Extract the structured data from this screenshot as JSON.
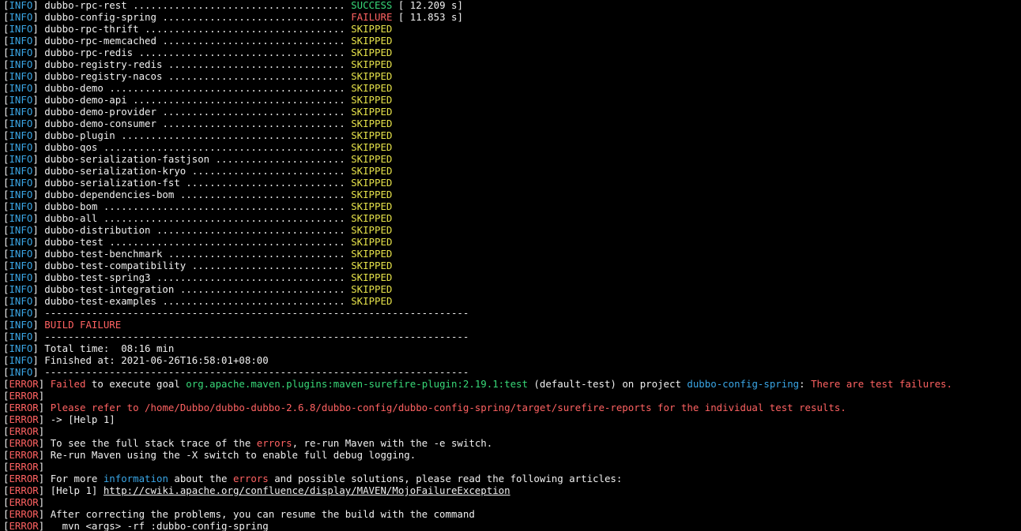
{
  "colors": {
    "background": "#000000",
    "text": "#f0f0f0",
    "info_level": "#3aa6e6",
    "error_level": "#ff6262",
    "success": "#38d878",
    "failure": "#ff6262",
    "skipped": "#e6e24a"
  },
  "modules": [
    {
      "name": "dubbo-rpc-rest",
      "dots": "....................................",
      "status": "SUCCESS",
      "time": " [ 12.209 s]"
    },
    {
      "name": "dubbo-config-spring",
      "dots": "...............................",
      "status": "FAILURE",
      "time": " [ 11.853 s]"
    },
    {
      "name": "dubbo-rpc-thrift",
      "dots": "..................................",
      "status": "SKIPPED",
      "time": ""
    },
    {
      "name": "dubbo-rpc-memcached",
      "dots": "...............................",
      "status": "SKIPPED",
      "time": ""
    },
    {
      "name": "dubbo-rpc-redis",
      "dots": "...................................",
      "status": "SKIPPED",
      "time": ""
    },
    {
      "name": "dubbo-registry-redis",
      "dots": "..............................",
      "status": "SKIPPED",
      "time": ""
    },
    {
      "name": "dubbo-registry-nacos",
      "dots": "..............................",
      "status": "SKIPPED",
      "time": ""
    },
    {
      "name": "dubbo-demo",
      "dots": "........................................",
      "status": "SKIPPED",
      "time": ""
    },
    {
      "name": "dubbo-demo-api",
      "dots": "....................................",
      "status": "SKIPPED",
      "time": ""
    },
    {
      "name": "dubbo-demo-provider",
      "dots": "...............................",
      "status": "SKIPPED",
      "time": ""
    },
    {
      "name": "dubbo-demo-consumer",
      "dots": "...............................",
      "status": "SKIPPED",
      "time": ""
    },
    {
      "name": "dubbo-plugin",
      "dots": "......................................",
      "status": "SKIPPED",
      "time": ""
    },
    {
      "name": "dubbo-qos",
      "dots": ".........................................",
      "status": "SKIPPED",
      "time": ""
    },
    {
      "name": "dubbo-serialization-fastjson",
      "dots": "......................",
      "status": "SKIPPED",
      "time": ""
    },
    {
      "name": "dubbo-serialization-kryo",
      "dots": "..........................",
      "status": "SKIPPED",
      "time": ""
    },
    {
      "name": "dubbo-serialization-fst",
      "dots": "...........................",
      "status": "SKIPPED",
      "time": ""
    },
    {
      "name": "dubbo-dependencies-bom",
      "dots": "............................",
      "status": "SKIPPED",
      "time": ""
    },
    {
      "name": "dubbo-bom",
      "dots": ".........................................",
      "status": "SKIPPED",
      "time": ""
    },
    {
      "name": "dubbo-all",
      "dots": ".........................................",
      "status": "SKIPPED",
      "time": ""
    },
    {
      "name": "dubbo-distribution",
      "dots": "................................",
      "status": "SKIPPED",
      "time": ""
    },
    {
      "name": "dubbo-test",
      "dots": "........................................",
      "status": "SKIPPED",
      "time": ""
    },
    {
      "name": "dubbo-test-benchmark",
      "dots": "..............................",
      "status": "SKIPPED",
      "time": ""
    },
    {
      "name": "dubbo-test-compatibility",
      "dots": "..........................",
      "status": "SKIPPED",
      "time": ""
    },
    {
      "name": "dubbo-test-spring3",
      "dots": "................................",
      "status": "SKIPPED",
      "time": ""
    },
    {
      "name": "dubbo-test-integration",
      "dots": "............................",
      "status": "SKIPPED",
      "time": ""
    },
    {
      "name": "dubbo-test-examples",
      "dots": "...............................",
      "status": "SKIPPED",
      "time": ""
    }
  ],
  "summary": {
    "info_tag": "INFO",
    "error_tag": "ERROR",
    "separator": "------------------------------------------------------------------------",
    "build_result": "BUILD FAILURE",
    "total_time": "Total time:  08:16 min",
    "finished_at": "Finished at: 2021-06-26T16:58:01+08:00"
  },
  "errors": {
    "failed_word": "Failed",
    "to_execute_goal": " to execute goal ",
    "goal": "org.apache.maven.plugins:maven-surefire-plugin:2.19.1:test",
    "default_test": " (default-test) on project ",
    "project": "dubbo-config-spring",
    "colon": ": ",
    "test_failures": "There are test failures.",
    "please_refer": "Please refer to /home/Dubbo/dubbo-dubbo-2.6.8/dubbo-config/dubbo-config-spring/target/surefire-reports for the individual test results.",
    "help_ref": "-> [Help 1]",
    "stack_trace_1": "To see the full stack trace of the ",
    "errors_word": "errors",
    "stack_trace_2": ", re-run Maven with the -e switch.",
    "debug_logging": "Re-run Maven using the -X switch to enable full debug logging.",
    "more_info_1": "For more ",
    "information_word": "information",
    "more_info_2": " about the ",
    "more_info_3": " and possible solutions, please read the following articles:",
    "help1_label": "[Help 1] ",
    "help1_url": "http://cwiki.apache.org/confluence/display/MAVEN/MojoFailureException",
    "after_correcting": "After correcting the problems, you can resume the build with the command",
    "resume_command": "  mvn <args> -rf :dubbo-config-spring"
  }
}
